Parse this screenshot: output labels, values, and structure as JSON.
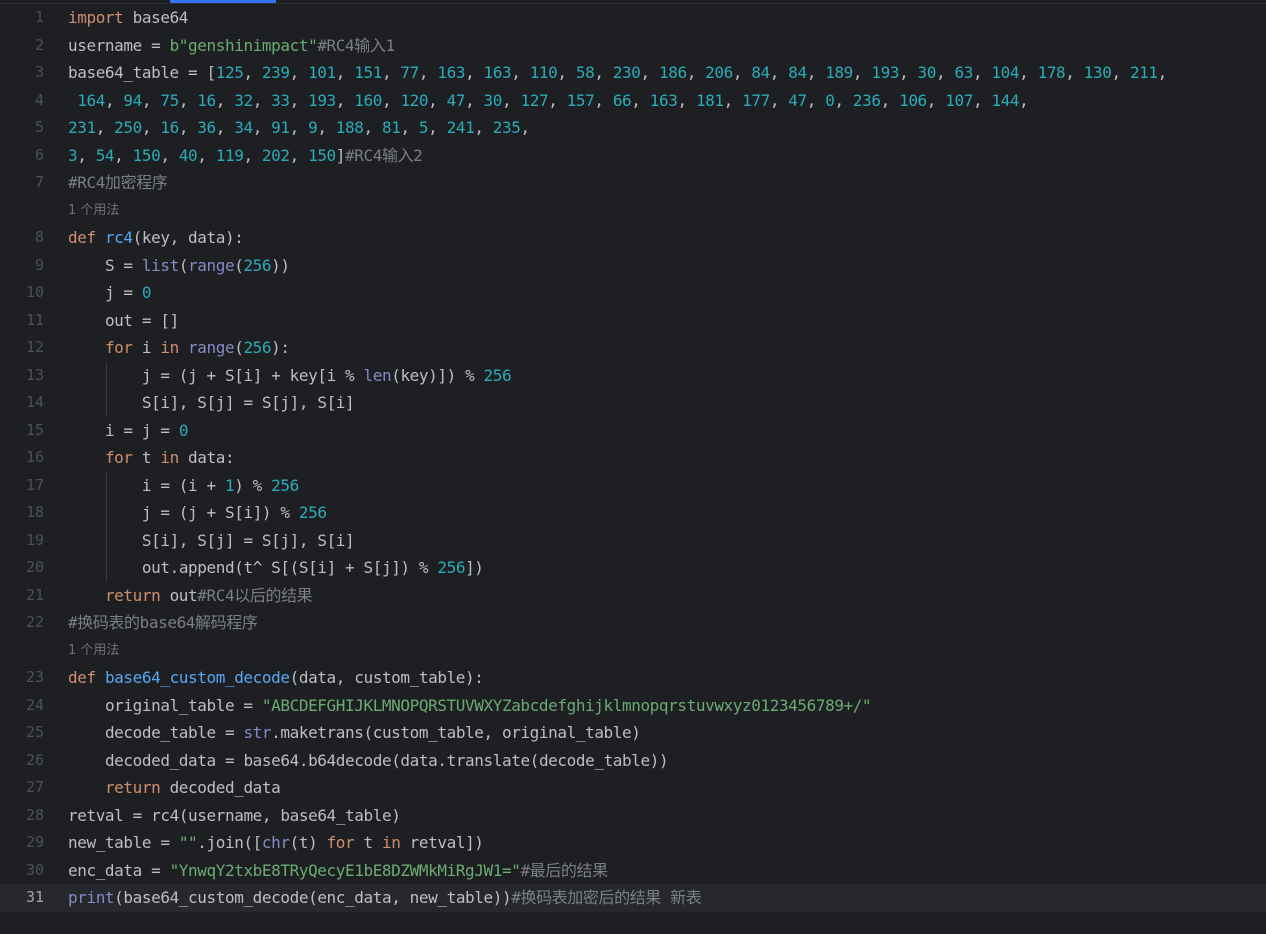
{
  "editor": {
    "lines": [
      {
        "n": "1",
        "code": "import base64"
      },
      {
        "n": "2",
        "code": "username = b\"genshinimpact\"#RC4输入1"
      },
      {
        "n": "3",
        "code": "base64_table = [125, 239, 101, 151, 77, 163, 163, 110, 58, 230, 186, 206, 84, 84, 189, 193, 30, 63, 104, 178, 130, 211,"
      },
      {
        "n": "4",
        "code": " 164, 94, 75, 16, 32, 33, 193, 160, 120, 47, 30, 127, 157, 66, 163, 181, 177, 47, 0, 236, 106, 107, 144,"
      },
      {
        "n": "5",
        "code": "231, 250, 16, 36, 34, 91, 9, 188, 81, 5, 241, 235,"
      },
      {
        "n": "6",
        "code": "3, 54, 150, 40, 119, 202, 150]#RC4输入2"
      },
      {
        "n": "7",
        "code": "#RC4加密程序"
      },
      {
        "hint": "1 个用法"
      },
      {
        "n": "8",
        "code": "def rc4(key, data):"
      },
      {
        "n": "9",
        "code": "    S = list(range(256))"
      },
      {
        "n": "10",
        "code": "    j = 0"
      },
      {
        "n": "11",
        "code": "    out = []"
      },
      {
        "n": "12",
        "code": "    for i in range(256):"
      },
      {
        "n": "13",
        "code": "        j = (j + S[i] + key[i % len(key)]) % 256"
      },
      {
        "n": "14",
        "code": "        S[i], S[j] = S[j], S[i]"
      },
      {
        "n": "15",
        "code": "    i = j = 0"
      },
      {
        "n": "16",
        "code": "    for t in data:"
      },
      {
        "n": "17",
        "code": "        i = (i + 1) % 256"
      },
      {
        "n": "18",
        "code": "        j = (j + S[i]) % 256"
      },
      {
        "n": "19",
        "code": "        S[i], S[j] = S[j], S[i]"
      },
      {
        "n": "20",
        "code": "        out.append(t^ S[(S[i] + S[j]) % 256])"
      },
      {
        "n": "21",
        "code": "    return out#RC4以后的结果"
      },
      {
        "n": "22",
        "code": "#换码表的base64解码程序"
      },
      {
        "hint": "1 个用法"
      },
      {
        "n": "23",
        "code": "def base64_custom_decode(data, custom_table):"
      },
      {
        "n": "24",
        "code": "    original_table = \"ABCDEFGHIJKLMNOPQRSTUVWXYZabcdefghijklmnopqrstuvwxyz0123456789+/\""
      },
      {
        "n": "25",
        "code": "    decode_table = str.maketrans(custom_table, original_table)"
      },
      {
        "n": "26",
        "code": "    decoded_data = base64.b64decode(data.translate(decode_table))"
      },
      {
        "n": "27",
        "code": "    return decoded_data"
      },
      {
        "n": "28",
        "code": "retval = rc4(username, base64_table)"
      },
      {
        "n": "29",
        "code": "new_table = \"\".join([chr(t) for t in retval])"
      },
      {
        "n": "30",
        "code": "enc_data = \"YnwqY2txbE8TRyQecyE1bE8DZWMkMiRgJW1=\"#最后的结果"
      },
      {
        "n": "31",
        "code": "print(base64_custom_decode(enc_data, new_table))#换码表加密后的结果 新表",
        "current": true
      }
    ]
  },
  "colors": {
    "keyword": "#cf8e6d",
    "number": "#2aacb8",
    "string": "#6aab73",
    "comment": "#7a7e85",
    "function": "#56a8f5",
    "builtin": "#8888c6",
    "default": "#bcbec4"
  }
}
